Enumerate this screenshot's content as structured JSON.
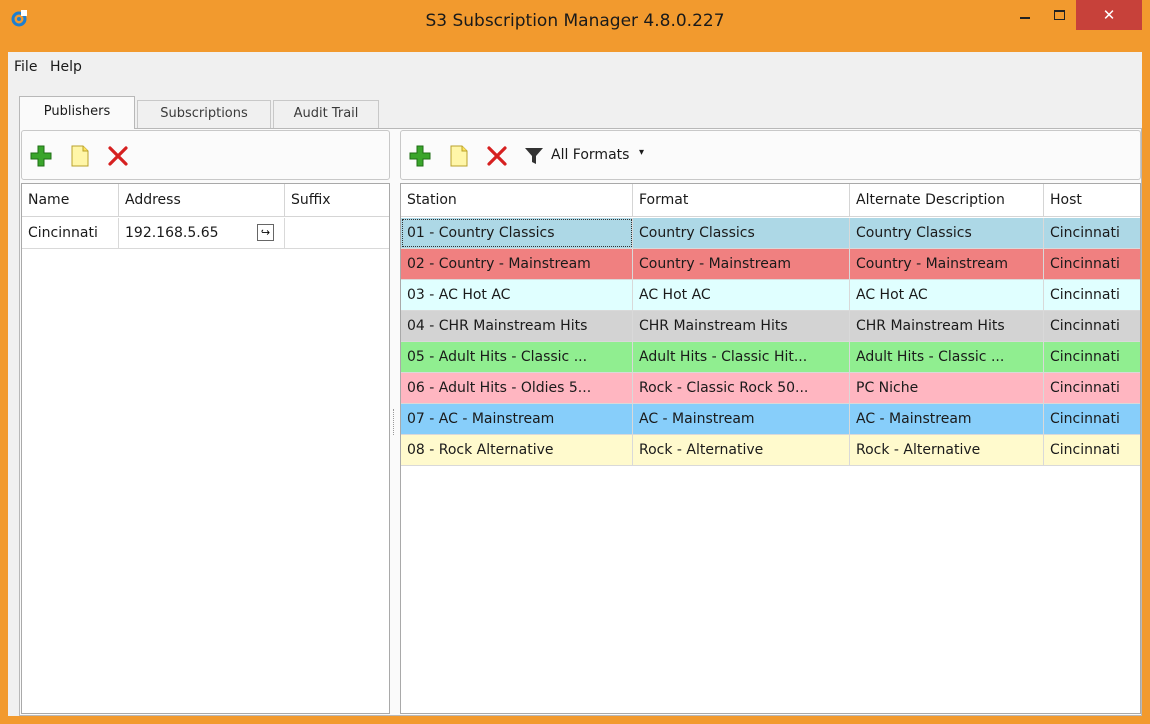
{
  "window": {
    "title": "S3 Subscription Manager 4.8.0.227",
    "close_glyph": "✕"
  },
  "menu": {
    "items": [
      "File",
      "Help"
    ]
  },
  "tabs": [
    {
      "label": "Publishers",
      "active": true
    },
    {
      "label": "Subscriptions",
      "active": false
    },
    {
      "label": "Audit Trail",
      "active": false
    }
  ],
  "publishers": {
    "toolbar": {
      "icons": [
        "add-icon",
        "edit-icon",
        "delete-icon"
      ]
    },
    "columns": [
      "Name",
      "Address",
      "Suffix"
    ],
    "rows": [
      {
        "name": "Cincinnati",
        "address": "192.168.5.65",
        "suffix": ""
      }
    ],
    "address_button_glyph": "↪"
  },
  "formats": {
    "toolbar": {
      "icons": [
        "add-icon",
        "edit-icon",
        "delete-icon",
        "filter-icon"
      ],
      "filter_label": "All Formats",
      "filter_caret": "▾"
    },
    "columns": [
      "Station",
      "Format",
      "Alternate Description",
      "Host"
    ],
    "rows": [
      {
        "station": "01 - Country Classics",
        "format": "Country Classics",
        "alt": "Country Classics",
        "host": "Cincinnati",
        "color": "#add8e6"
      },
      {
        "station": "02 - Country - Mainstream",
        "format": "Country - Mainstream",
        "alt": "Country - Mainstream",
        "host": "Cincinnati",
        "color": "#f08080"
      },
      {
        "station": "03 - AC Hot AC",
        "format": "AC Hot AC",
        "alt": "AC Hot AC",
        "host": "Cincinnati",
        "color": "#e0ffff"
      },
      {
        "station": "04 - CHR Mainstream Hits",
        "format": "CHR Mainstream Hits",
        "alt": "CHR Mainstream Hits",
        "host": "Cincinnati",
        "color": "#d3d3d3"
      },
      {
        "station": "05 - Adult Hits - Classic ...",
        "format": "Adult Hits - Classic Hit...",
        "alt": "Adult Hits - Classic ...",
        "host": "Cincinnati",
        "color": "#90ee90"
      },
      {
        "station": "06 - Adult Hits - Oldies 5...",
        "format": "Rock - Classic Rock 50...",
        "alt": "PC Niche",
        "host": "Cincinnati",
        "color": "#ffb6c1"
      },
      {
        "station": "07 - AC - Mainstream",
        "format": "AC - Mainstream",
        "alt": "AC - Mainstream",
        "host": "Cincinnati",
        "color": "#87cefa"
      },
      {
        "station": "08 - Rock Alternative",
        "format": "Rock - Alternative",
        "alt": "Rock - Alternative",
        "host": "Cincinnati",
        "color": "#fffacd"
      }
    ]
  }
}
